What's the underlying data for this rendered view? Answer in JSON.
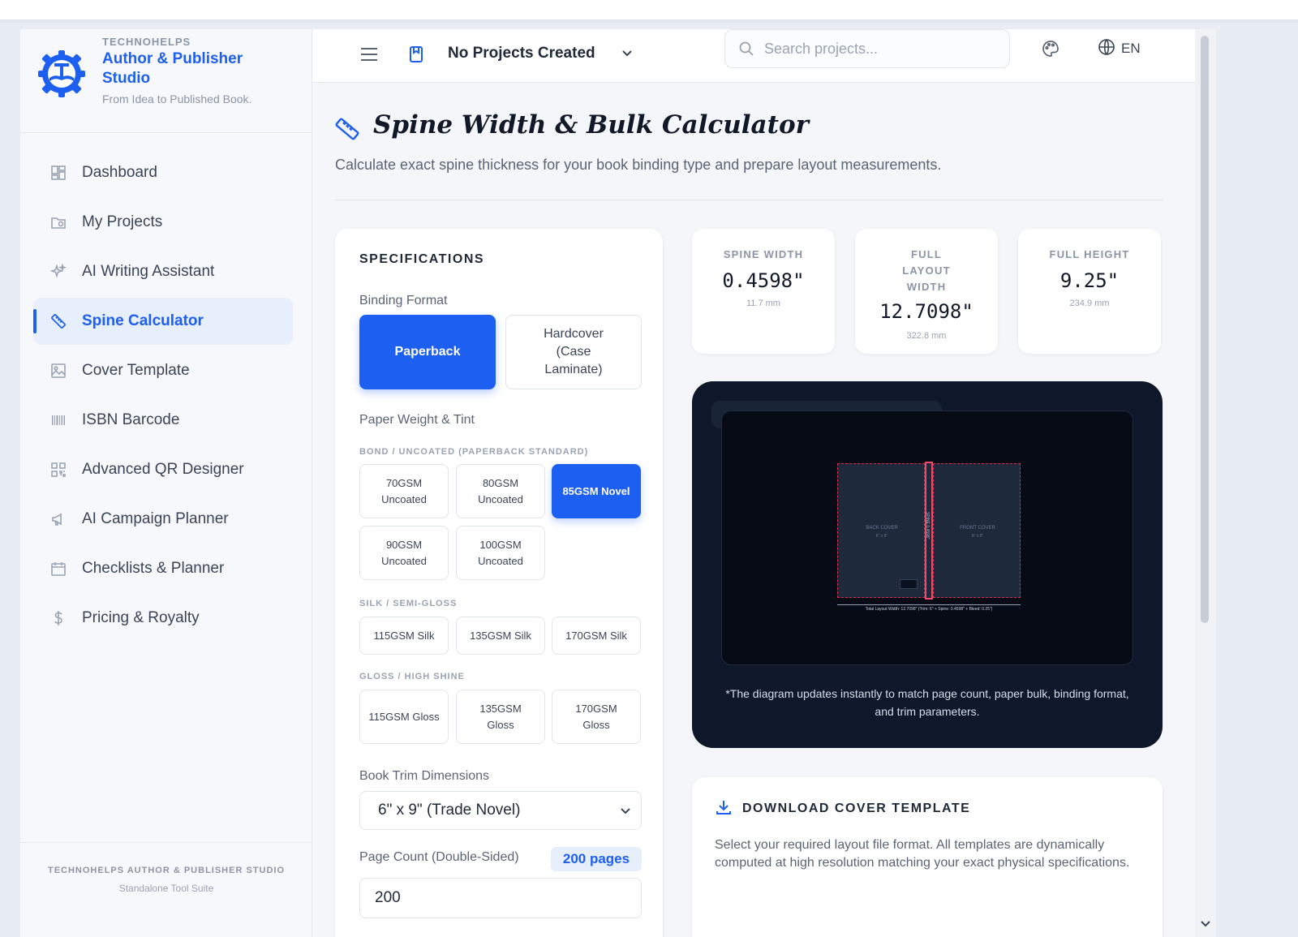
{
  "brand": {
    "company": "TECHNOHELPS",
    "name": "Author & Publisher Studio",
    "tagline": "From Idea to Published Book."
  },
  "sidebar": {
    "items": [
      {
        "label": "Dashboard",
        "icon": "dashboard-icon"
      },
      {
        "label": "My Projects",
        "icon": "projects-icon"
      },
      {
        "label": "AI Writing Assistant",
        "icon": "sparkles-icon"
      },
      {
        "label": "Spine Calculator",
        "icon": "ruler-icon",
        "active": true
      },
      {
        "label": "Cover Template",
        "icon": "image-icon"
      },
      {
        "label": "ISBN Barcode",
        "icon": "barcode-icon"
      },
      {
        "label": "Advanced QR Designer",
        "icon": "qr-icon"
      },
      {
        "label": "AI Campaign Planner",
        "icon": "megaphone-icon"
      },
      {
        "label": "Checklists & Planner",
        "icon": "calendar-icon"
      },
      {
        "label": "Pricing & Royalty",
        "icon": "dollar-icon"
      }
    ],
    "footer_title": "TECHNOHELPS AUTHOR & PUBLISHER STUDIO",
    "footer_sub": "Standalone Tool Suite"
  },
  "topbar": {
    "project_select": "No Projects Created",
    "search_placeholder": "Search projects...",
    "language": "EN"
  },
  "page": {
    "title": "Spine Width & Bulk Calculator",
    "subtitle": "Calculate exact spine thickness for your book binding type and prepare layout measurements."
  },
  "specs": {
    "heading": "SPECIFICATIONS",
    "binding_label": "Binding Format",
    "binding_selected": "Paperback",
    "binding_other": "Hardcover (Case Laminate)",
    "paper_label": "Paper Weight & Tint",
    "uncoated_label": "BOND / UNCOATED (PAPERBACK STANDARD)",
    "uncoated": [
      "70GSM Uncoated",
      "80GSM Uncoated",
      "85GSM Novel",
      "90GSM Uncoated",
      "100GSM Uncoated"
    ],
    "silk_label": "SILK / SEMI-GLOSS",
    "silk": [
      "115GSM Silk",
      "135GSM Silk",
      "170GSM Silk"
    ],
    "gloss_label": "GLOSS / HIGH SHINE",
    "gloss": [
      "115GSM Gloss",
      "135GSM Gloss",
      "170GSM Gloss"
    ],
    "selected_paper": "85GSM Novel",
    "trim_label": "Book Trim Dimensions",
    "trim_value": "6\" x 9\" (Trade Novel)",
    "pagecount_label": "Page Count (Double-Sided)",
    "pagecount_badge": "200 pages",
    "pagecount_value": "200"
  },
  "stats": {
    "spine": {
      "label": "SPINE WIDTH",
      "value": "0.4598\"",
      "metric": "11.7 mm"
    },
    "layout": {
      "label": "FULL LAYOUT WIDTH",
      "value": "12.7098\"",
      "metric": "322.8 mm"
    },
    "height": {
      "label": "FULL HEIGHT",
      "value": "9.25\"",
      "metric": "234.9 mm"
    }
  },
  "diagram": {
    "back_cover": "BACK COVER",
    "front_cover": "FRONT COVER",
    "spine_label": "SPINE 0.4598\"",
    "trim_small": "6\" x 9\"",
    "dimension_text": "Total Layout Width: 12.7098\" (Trim: 6\" + Spine: 0.4598\" + Bleed: 0.25\")",
    "note": "*The diagram updates instantly to match page count, paper bulk, binding format, and trim parameters."
  },
  "download": {
    "heading": "DOWNLOAD COVER TEMPLATE",
    "text": "Select your required layout file format. All templates are dynamically computed at high resolution matching your exact physical specifications."
  },
  "colors": {
    "accent": "#1d5ff0",
    "diagram_bg": "#0f172a",
    "bleed_line": "#dc2a4d"
  }
}
